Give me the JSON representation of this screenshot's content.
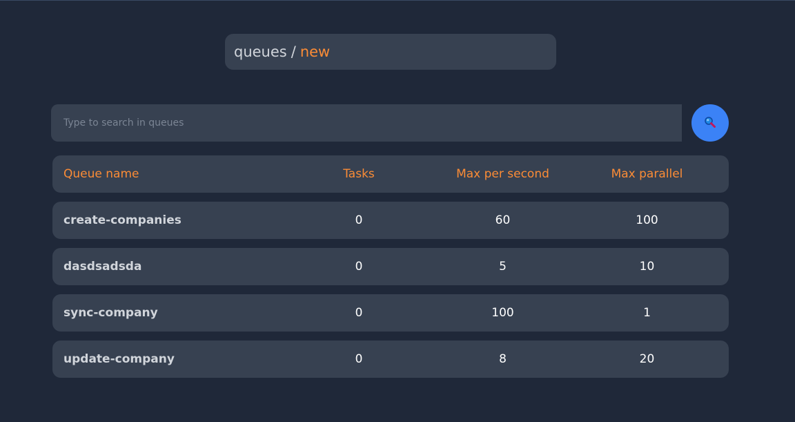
{
  "breadcrumb": {
    "root": "queues",
    "separator": "/",
    "current": "new"
  },
  "search": {
    "placeholder": "Type to search in queues",
    "value": "",
    "button_icon": "search-icon"
  },
  "table": {
    "columns": [
      "Queue name",
      "Tasks",
      "Max per second",
      "Max parallel"
    ],
    "rows": [
      {
        "name": "create-companies",
        "tasks": "0",
        "max_per_second": "60",
        "max_parallel": "100"
      },
      {
        "name": "dasdsadsda",
        "tasks": "0",
        "max_per_second": "5",
        "max_parallel": "10"
      },
      {
        "name": "sync-company",
        "tasks": "0",
        "max_per_second": "100",
        "max_parallel": "1"
      },
      {
        "name": "update-company",
        "tasks": "0",
        "max_per_second": "8",
        "max_parallel": "20"
      }
    ]
  },
  "colors": {
    "background": "#1f2839",
    "card": "#374151",
    "accent": "#fb8c36",
    "button": "#3b82f6"
  }
}
